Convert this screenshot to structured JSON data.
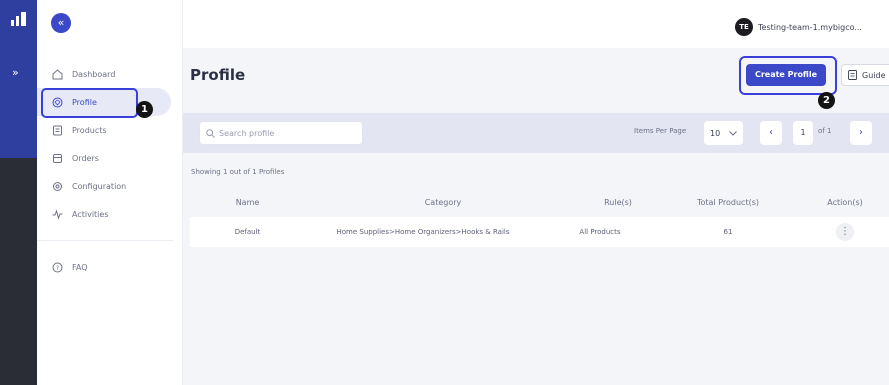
{
  "account": {
    "initials": "TE",
    "name": "Testing-team-1.mybigco..."
  },
  "rail": {
    "expand_icon": "»"
  },
  "sidebar": {
    "collapse_icon": "«",
    "items": [
      {
        "label": "Dashboard",
        "icon": "home-icon"
      },
      {
        "label": "Profile",
        "icon": "profile-icon",
        "active": true
      },
      {
        "label": "Products",
        "icon": "products-icon"
      },
      {
        "label": "Orders",
        "icon": "orders-icon"
      },
      {
        "label": "Configuration",
        "icon": "gear-icon"
      },
      {
        "label": "Activities",
        "icon": "activity-icon"
      }
    ],
    "footer_items": [
      {
        "label": "FAQ",
        "icon": "help-icon"
      }
    ]
  },
  "annotations": {
    "badge1": "1",
    "badge2": "2",
    "highlight_color": "#3b3fd9"
  },
  "page": {
    "title": "Profile",
    "create_button": "Create Profile",
    "guide_button": "Guide",
    "search_placeholder": "Search profile",
    "items_per_page_label": "Items Per Page",
    "items_per_page_value": "10",
    "page_current": "1",
    "page_of": "of 1",
    "prev": "‹",
    "next": "›",
    "showing_text": "Showing 1 out of 1 Profiles"
  },
  "table": {
    "columns": [
      "Name",
      "Category",
      "Rule(s)",
      "Total Product(s)",
      "Action(s)"
    ],
    "rows": [
      {
        "name": "Default",
        "category": "Home Supplies>Home Organizers>Hooks & Rails",
        "rules": "All Products",
        "total": "61",
        "action": "⋮"
      }
    ]
  },
  "colors": {
    "brand": "#3b49c9",
    "rail": "#2b2d36",
    "rail_top": "#2f3fa0",
    "toolbar": "#e3e5f3"
  }
}
